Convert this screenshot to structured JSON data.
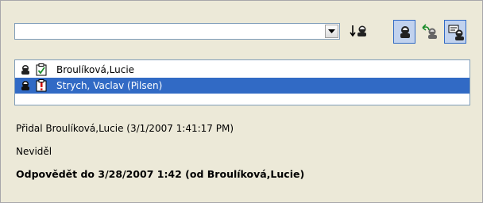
{
  "toolbar": {
    "combo_value": "",
    "icons": [
      "sort-down-person-icon",
      "person-icon",
      "reply-person-icon",
      "message-person-icon"
    ]
  },
  "list": {
    "rows": [
      {
        "label": "Broulíková,Lucie",
        "status_icon": "checkbox-checked-icon",
        "selected": false
      },
      {
        "label": "Strych, Vaclav (Pilsen)",
        "status_icon": "warning-exclamation-icon",
        "selected": true
      }
    ]
  },
  "info": {
    "added_by": "Přidal Broulíková,Lucie (3/1/2007 1:41:17 PM)",
    "seen_status": "Neviděl",
    "reply_by": "Odpovědět do 3/28/2007 1:42 (od Broulíková,Lucie)"
  },
  "colors": {
    "selection": "#316ac5",
    "panel": "#ece9d8"
  }
}
